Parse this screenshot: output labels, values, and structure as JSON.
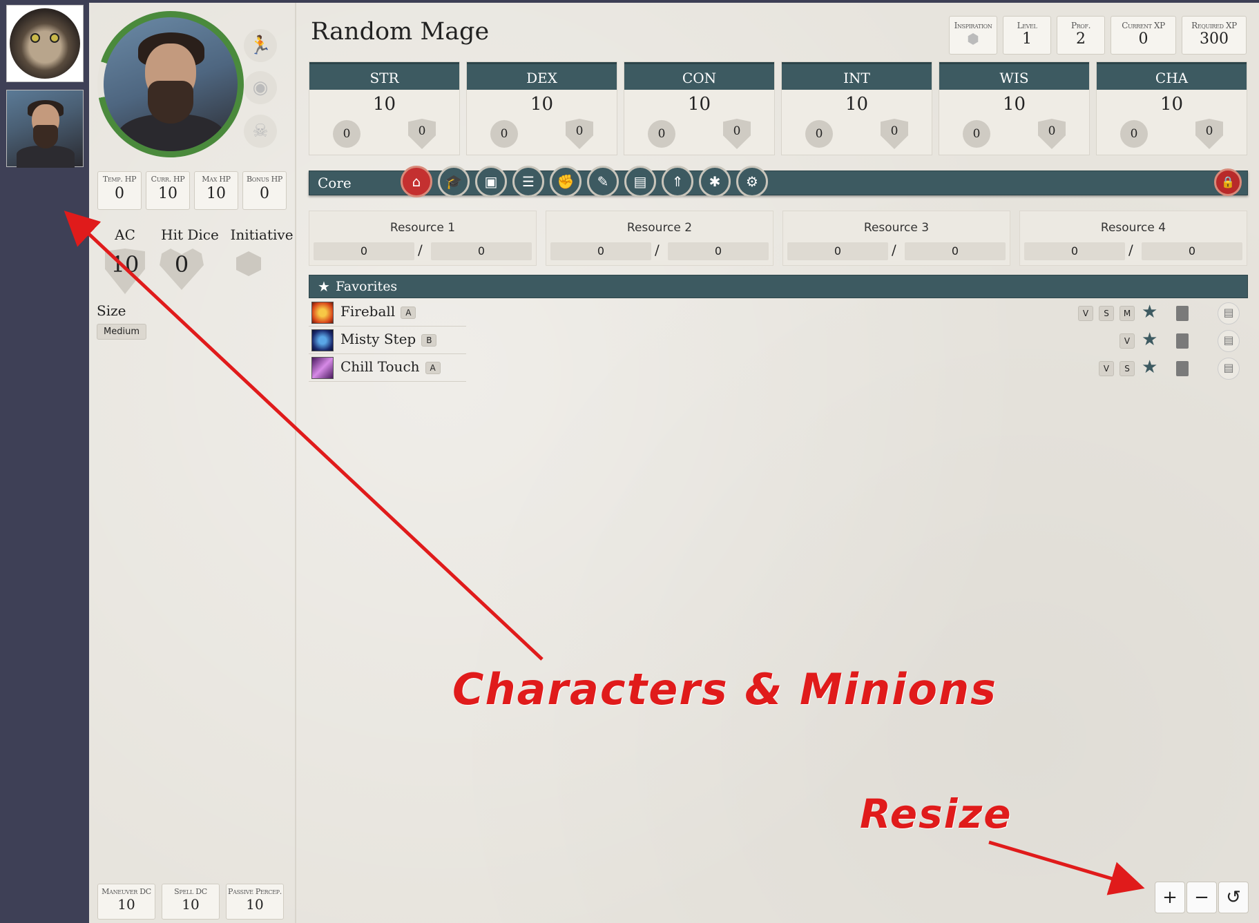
{
  "character": {
    "name": "Random Mage",
    "hp": [
      {
        "label": "Temp. HP",
        "value": "0"
      },
      {
        "label": "Curr. HP",
        "value": "10"
      },
      {
        "label": "Max HP",
        "value": "10"
      },
      {
        "label": "Bonus HP",
        "value": "0"
      }
    ],
    "ac": {
      "label": "AC",
      "value": "10"
    },
    "hit_dice": {
      "label": "Hit Dice",
      "value": "0"
    },
    "initiative": {
      "label": "Initiative"
    },
    "size": {
      "label": "Size",
      "value": "Medium"
    },
    "dcs": [
      {
        "label": "Maneuver DC",
        "value": "10"
      },
      {
        "label": "Spell DC",
        "value": "10"
      },
      {
        "label": "Passive Percep.",
        "value": "10"
      }
    ]
  },
  "header_badges": [
    {
      "label": "Inspiration",
      "value": ""
    },
    {
      "label": "Level",
      "value": "1"
    },
    {
      "label": "Prof.",
      "value": "2"
    },
    {
      "label": "Current XP",
      "value": "0"
    },
    {
      "label": "Required XP",
      "value": "300"
    }
  ],
  "abilities": [
    {
      "name": "STR",
      "score": "10",
      "mod": "0",
      "save": "0"
    },
    {
      "name": "DEX",
      "score": "10",
      "mod": "0",
      "save": "0"
    },
    {
      "name": "CON",
      "score": "10",
      "mod": "0",
      "save": "0"
    },
    {
      "name": "INT",
      "score": "10",
      "mod": "0",
      "save": "0"
    },
    {
      "name": "WIS",
      "score": "10",
      "mod": "0",
      "save": "0"
    },
    {
      "name": "CHA",
      "score": "10",
      "mod": "0",
      "save": "0"
    }
  ],
  "tabbar": {
    "title": "Core",
    "tabs": [
      {
        "icon": "home-icon",
        "glyph": "⌂"
      },
      {
        "icon": "graduation-cap-icon",
        "glyph": "🎓"
      },
      {
        "icon": "box-icon",
        "glyph": "▣"
      },
      {
        "icon": "list-icon",
        "glyph": "☰"
      },
      {
        "icon": "fist-icon",
        "glyph": "✊"
      },
      {
        "icon": "wand-icon",
        "glyph": "✎"
      },
      {
        "icon": "document-icon",
        "glyph": "▤"
      },
      {
        "icon": "chevrons-up-icon",
        "glyph": "⇑"
      },
      {
        "icon": "bug-icon",
        "glyph": "✱"
      },
      {
        "icon": "gear-icon",
        "glyph": "⚙"
      }
    ],
    "lock_glyph": "🔒"
  },
  "resources": [
    {
      "name": "Resource 1",
      "current": "0",
      "max": "0"
    },
    {
      "name": "Resource 2",
      "current": "0",
      "max": "0"
    },
    {
      "name": "Resource 3",
      "current": "0",
      "max": "0"
    },
    {
      "name": "Resource 4",
      "current": "0",
      "max": "0"
    }
  ],
  "favorites": {
    "title": "Favorites",
    "items": [
      {
        "name": "Fireball",
        "tag": "A",
        "components": [
          "V",
          "S",
          "M"
        ],
        "icon_colors": [
          "#f7c846",
          "#d9471a"
        ]
      },
      {
        "name": "Misty Step",
        "tag": "B",
        "components": [
          "V"
        ],
        "icon_colors": [
          "#5aa6e6",
          "#1a2a6e"
        ]
      },
      {
        "name": "Chill Touch",
        "tag": "A",
        "components": [
          "V",
          "S"
        ],
        "icon_colors": [
          "#d68ae6",
          "#4a1a5e"
        ]
      }
    ]
  },
  "resize_controls": [
    {
      "label": "+"
    },
    {
      "label": "−"
    },
    {
      "label": "↺"
    }
  ],
  "annotations": {
    "characters": "Characters & Minions",
    "resize": "Resize"
  },
  "colors": {
    "accent": "#3d5a61",
    "active_tab": "#c43030",
    "hp_ring": "#4a8a3c",
    "annotation": "#e01b1b"
  }
}
